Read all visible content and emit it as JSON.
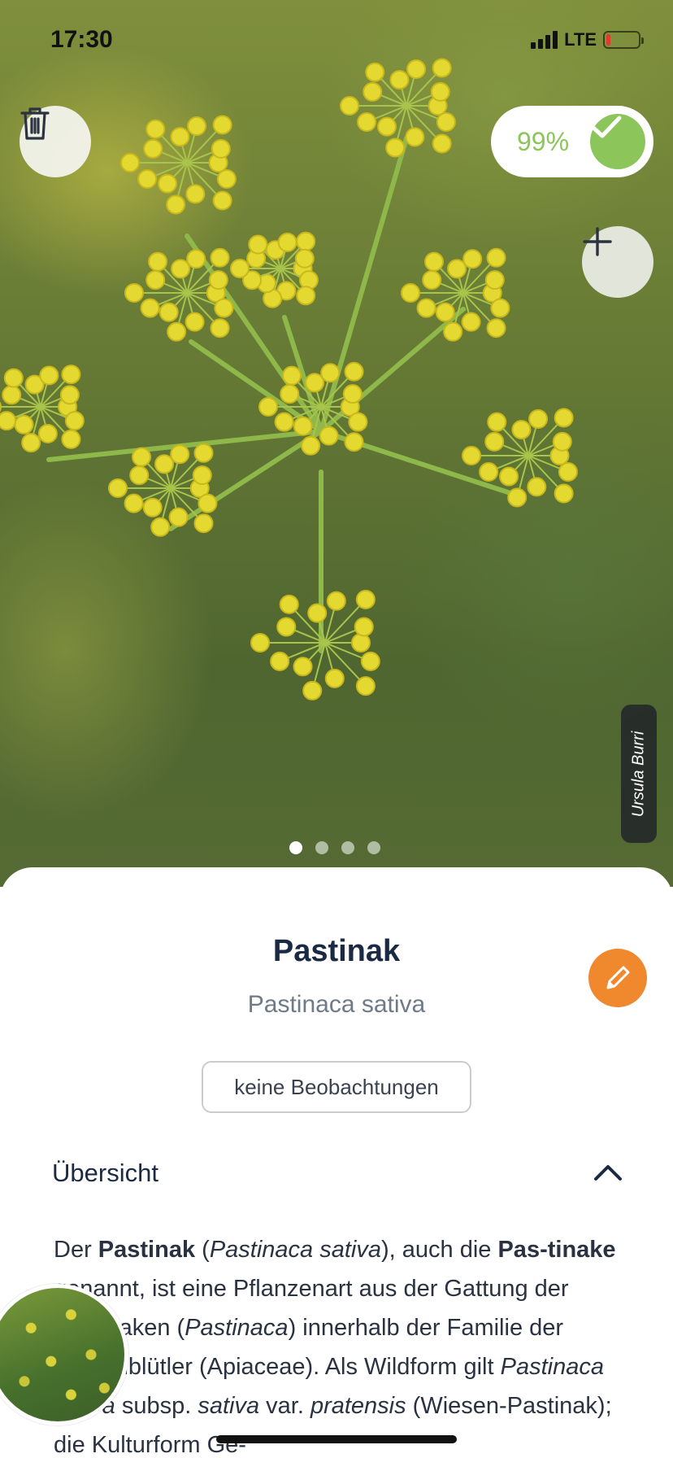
{
  "status_bar": {
    "time": "17:30",
    "network": "LTE",
    "signal_bars": 4,
    "battery_level": 0.12
  },
  "photo": {
    "confidence_label": "99%",
    "credit": "Ursula Burri",
    "page_count": 4,
    "active_page": 1,
    "icons": {
      "delete": "trash-icon",
      "confidence": "checkmark-icon",
      "add": "plus-icon"
    }
  },
  "species": {
    "common_name": "Pastinak",
    "scientific_name": "Pastinaca sativa",
    "observations_label": "keine Beobachtungen",
    "edit_icon": "pencil-icon"
  },
  "overview": {
    "title": "Übersicht",
    "expanded": true,
    "text": {
      "p1": "Der ",
      "b1": "Pastinak",
      "p2": " (",
      "i1": "Pastinaca sativa",
      "p3": "), auch die ",
      "b2": "Pas-tinake",
      "p4": " genannt, ist eine Pflanzenart aus der Gattung der Pastinaken (",
      "i2": "Pastinaca",
      "p5": ") innerhalb der Familie der Doldenblütler (Apiaceae). Als Wildform gilt ",
      "i3": "Pastinaca sativa",
      "p6": " subsp. ",
      "i4": "sativa",
      "p7": " var. ",
      "i5": "pratensis",
      "p8": " (Wiesen-Pastinak); die Kulturform Ge-"
    }
  },
  "colors": {
    "accent_green": "#8cc55a",
    "edit_orange": "#f0882e",
    "title_navy": "#1b2a44"
  }
}
